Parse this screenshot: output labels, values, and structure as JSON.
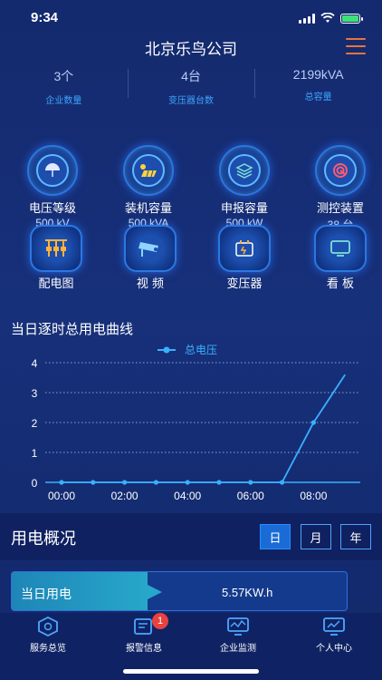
{
  "status_bar": {
    "time": "9:34"
  },
  "header": {
    "title": "北京乐鸟公司"
  },
  "stats": [
    {
      "value": "3个",
      "label": "企业数量"
    },
    {
      "value": "4台",
      "label": "变压器台数"
    },
    {
      "value": "2199kVA",
      "label": "总容量"
    }
  ],
  "grid": {
    "row1": [
      {
        "label": "电压等级",
        "sub": "500 kV",
        "icon": "umbrella-icon"
      },
      {
        "label": "装机容量",
        "sub": "500 kVA",
        "icon": "solar-panel-icon"
      },
      {
        "label": "申报容量",
        "sub": "500 kW",
        "icon": "layers-icon"
      },
      {
        "label": "测控装置",
        "sub": "38 台",
        "icon": "gauge-icon"
      }
    ],
    "row2": [
      {
        "label": "配电图",
        "icon": "distribution-icon"
      },
      {
        "label": "视 频",
        "icon": "camera-icon"
      },
      {
        "label": "变压器",
        "icon": "transformer-icon"
      },
      {
        "label": "看 板",
        "icon": "monitor-icon"
      }
    ]
  },
  "chart_title": "当日逐时总用电曲线",
  "chart_data": {
    "type": "line",
    "legend": "总电压",
    "x": [
      "00:00",
      "01:00",
      "02:00",
      "03:00",
      "04:00",
      "05:00",
      "06:00",
      "07:00",
      "08:00",
      "09:00"
    ],
    "x_tick_labels": [
      "00:00",
      "02:00",
      "04:00",
      "06:00",
      "08:00"
    ],
    "y_tick_labels": [
      "0",
      "1",
      "2",
      "3",
      "4"
    ],
    "ylim": [
      0,
      4
    ],
    "series": [
      {
        "name": "总电压",
        "values": [
          0,
          0,
          0,
          0,
          0,
          0,
          0,
          0,
          2,
          3.6
        ]
      }
    ],
    "grid": true,
    "legend_position": "top-center",
    "color": "#3ab0ff"
  },
  "summary": {
    "title": "用电概况",
    "periods": [
      "日",
      "月",
      "年"
    ],
    "active_period": "日",
    "usage_label": "当日用电",
    "usage_value": "5.57KW.h"
  },
  "tabs": [
    {
      "label": "服务总览",
      "icon": "service-icon"
    },
    {
      "label": "报警信息",
      "icon": "alarm-icon",
      "badge": "1"
    },
    {
      "label": "企业监测",
      "icon": "monitor-icon"
    },
    {
      "label": "个人中心",
      "icon": "personal-icon"
    }
  ]
}
